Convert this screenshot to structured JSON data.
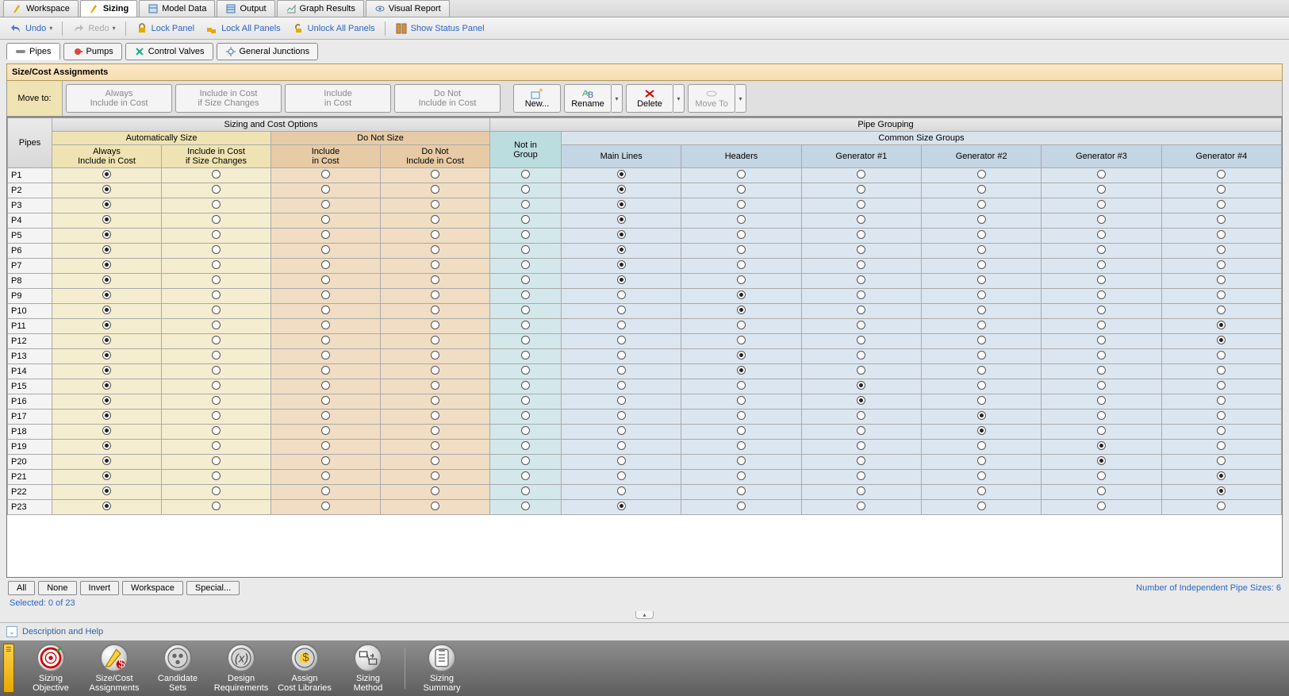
{
  "topTabs": [
    {
      "label": "Workspace",
      "active": false
    },
    {
      "label": "Sizing",
      "active": true
    },
    {
      "label": "Model Data",
      "active": false
    },
    {
      "label": "Output",
      "active": false
    },
    {
      "label": "Graph Results",
      "active": false
    },
    {
      "label": "Visual Report",
      "active": false
    }
  ],
  "toolbar": {
    "undo": "Undo",
    "redo": "Redo",
    "lockPanel": "Lock Panel",
    "lockAll": "Lock All Panels",
    "unlockAll": "Unlock All Panels",
    "showStatus": "Show Status Panel"
  },
  "subTabs": [
    {
      "label": "Pipes",
      "active": true
    },
    {
      "label": "Pumps",
      "active": false
    },
    {
      "label": "Control Valves",
      "active": false
    },
    {
      "label": "General Junctions",
      "active": false
    }
  ],
  "panelTitle": "Size/Cost Assignments",
  "moveTo": {
    "label": "Move to:",
    "buttons": [
      {
        "l1": "Always",
        "l2": "Include in Cost"
      },
      {
        "l1": "Include in Cost",
        "l2": "if Size Changes"
      },
      {
        "l1": "Include",
        "l2": "in Cost"
      },
      {
        "l1": "Do Not",
        "l2": "Include in Cost"
      }
    ]
  },
  "actions": {
    "new": "New...",
    "rename": "Rename",
    "delete": "Delete",
    "moveTo": "Move To"
  },
  "gridHeaders": {
    "pipes": "Pipes",
    "sizingCost": "Sizing and Cost Options",
    "autoSize": "Automatically Size",
    "doNotSize": "Do Not Size",
    "always": {
      "l1": "Always",
      "l2": "Include in Cost"
    },
    "ifChanges": {
      "l1": "Include in Cost",
      "l2": "if Size Changes"
    },
    "includeCost": {
      "l1": "Include",
      "l2": "in Cost"
    },
    "notInclude": {
      "l1": "Do Not",
      "l2": "Include in Cost"
    },
    "pipeGrouping": "Pipe Grouping",
    "notInGroup": {
      "l1": "Not in",
      "l2": "Group"
    },
    "commonGroups": "Common Size Groups",
    "groups": [
      "Main Lines",
      "Headers",
      "Generator #1",
      "Generator #2",
      "Generator #3",
      "Generator #4"
    ]
  },
  "rows": [
    {
      "name": "P1",
      "cost": 0,
      "group": 1
    },
    {
      "name": "P2",
      "cost": 0,
      "group": 1
    },
    {
      "name": "P3",
      "cost": 0,
      "group": 1
    },
    {
      "name": "P4",
      "cost": 0,
      "group": 1
    },
    {
      "name": "P5",
      "cost": 0,
      "group": 1
    },
    {
      "name": "P6",
      "cost": 0,
      "group": 1
    },
    {
      "name": "P7",
      "cost": 0,
      "group": 1
    },
    {
      "name": "P8",
      "cost": 0,
      "group": 1
    },
    {
      "name": "P9",
      "cost": 0,
      "group": 2
    },
    {
      "name": "P10",
      "cost": 0,
      "group": 2
    },
    {
      "name": "P11",
      "cost": 0,
      "group": 6
    },
    {
      "name": "P12",
      "cost": 0,
      "group": 6
    },
    {
      "name": "P13",
      "cost": 0,
      "group": 2
    },
    {
      "name": "P14",
      "cost": 0,
      "group": 2
    },
    {
      "name": "P15",
      "cost": 0,
      "group": 3
    },
    {
      "name": "P16",
      "cost": 0,
      "group": 3
    },
    {
      "name": "P17",
      "cost": 0,
      "group": 4
    },
    {
      "name": "P18",
      "cost": 0,
      "group": 4
    },
    {
      "name": "P19",
      "cost": 0,
      "group": 5
    },
    {
      "name": "P20",
      "cost": 0,
      "group": 5
    },
    {
      "name": "P21",
      "cost": 0,
      "group": 6
    },
    {
      "name": "P22",
      "cost": 0,
      "group": 6
    },
    {
      "name": "P23",
      "cost": 0,
      "group": 1
    }
  ],
  "selButtons": [
    "All",
    "None",
    "Invert",
    "Workspace",
    "Special..."
  ],
  "indSizes": "Number of Independent Pipe Sizes: 6",
  "selectedStatus": "Selected: 0 of 23",
  "descHelp": "Description and Help",
  "bottomNav": [
    {
      "l1": "Sizing",
      "l2": "Objective"
    },
    {
      "l1": "Size/Cost",
      "l2": "Assignments"
    },
    {
      "l1": "Candidate",
      "l2": "Sets"
    },
    {
      "l1": "Design",
      "l2": "Requirements"
    },
    {
      "l1": "Assign",
      "l2": "Cost Libraries"
    },
    {
      "l1": "Sizing",
      "l2": "Method"
    },
    {
      "l1": "Sizing",
      "l2": "Summary"
    }
  ]
}
